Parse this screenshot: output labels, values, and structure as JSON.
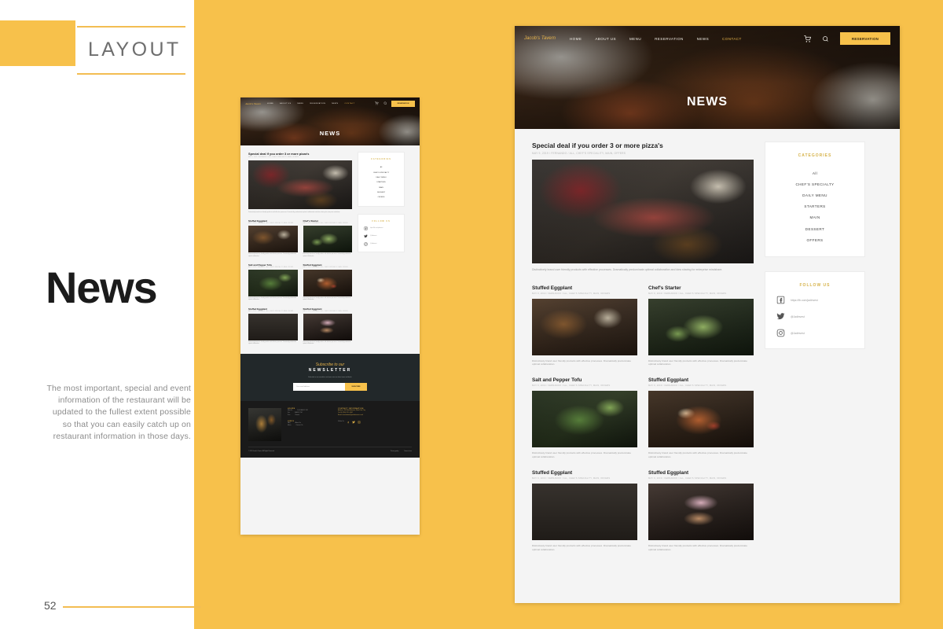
{
  "slide": {
    "section_label": "LAYOUT",
    "title": "News",
    "description": "The most important, special and event information of the restaurant will be updated to the fullest extent possible so that you can easily catch up on restaurant information in those days.",
    "page_number": "52",
    "accent_color": "#f7c14b",
    "text_gray": "#8c8c8c"
  },
  "site": {
    "brand": "Jacob's Tavern",
    "nav": [
      {
        "label": "HOME",
        "active": false
      },
      {
        "label": "ABOUT US",
        "active": false
      },
      {
        "label": "MENU",
        "active": false
      },
      {
        "label": "RESERVATION",
        "active": false
      },
      {
        "label": "NEWS",
        "active": false
      },
      {
        "label": "CONTACT",
        "active": true
      }
    ],
    "cart_icon": "cart-icon",
    "search_icon": "search-icon",
    "reservation_button": "RESERVATION",
    "hero_title": "NEWS"
  },
  "feature": {
    "title": "Special deal if you order 3 or more pizza's",
    "meta": "MAY 9, 2019 / FERNANDO / ALL, CHEF'S SPECIALITY, MAIN, OFFERS",
    "excerpt": "Distinctively brand user friendly products with effective processes. Dramatically predominate optimal collaboration and idea sharing for enterprise mindshare.",
    "image": "p-steak"
  },
  "cards": [
    {
      "title": "Stuffed Eggplant",
      "meta": "MAY 9, 2019 / FERNANDO / ALL, CHEF'S SPECIALITY, MAIN, OFFERS",
      "excerpt": "Distinctively brand user friendly products with effective processes. Dramatically predominate optimal collaboration.",
      "image": "p-board"
    },
    {
      "title": "Chef's Starter",
      "meta": "MAY 9, 2019 / FERNANDO / ALL, CHEF'S SPECIALITY, MAIN, OFFERS",
      "excerpt": "Distinctively brand user friendly products with effective processes. Dramatically predominate optimal collaboration.",
      "image": "p-macaron"
    },
    {
      "title": "Salt and Pepper Tofu",
      "meta": "MAY 9, 2019 / FERNANDO / ALL, CHEF'S SPECIALITY, MAIN, OFFERS",
      "excerpt": "Distinctively brand user friendly products with effective processes. Dramatically predominate optimal collaboration.",
      "image": "p-green"
    },
    {
      "title": "Stuffed Eggplant",
      "meta": "MAY 9, 2019 / FERNANDO / ALL, CHEF'S SPECIALITY, MAIN, OFFERS",
      "excerpt": "Distinctively brand user friendly products with effective processes. Dramatically predominate optimal collaboration.",
      "image": "p-pizza"
    },
    {
      "title": "Stuffed Eggplant",
      "meta": "MAY 9, 2019 / FERNANDO / ALL, CHEF'S SPECIALITY, MAIN, OFFERS",
      "excerpt": "Distinctively brand user friendly products with effective processes. Dramatically predominate optimal collaboration.",
      "image": "p-dark"
    },
    {
      "title": "Stuffed Eggplant",
      "meta": "MAY 9, 2019 / FERNANDO / ALL, CHEF'S SPECIALITY, MAIN, OFFERS",
      "excerpt": "Distinctively brand user friendly products with effective processes. Dramatically predominate optimal collaboration.",
      "image": "p-donut"
    }
  ],
  "sidebar": {
    "categories_title": "CATEGORIES",
    "categories": [
      "All",
      "CHEF'S SPECIALTY",
      "DAILY MENU",
      "STARTERS",
      "MAIN",
      "DESSERT",
      "OFFERS"
    ],
    "follow_title": "FOLLOW US",
    "socials": [
      {
        "icon": "facebook-icon",
        "handle": "https://fb.com/jadinvest"
      },
      {
        "icon": "twitter-icon",
        "handle": "@Jadinvest"
      },
      {
        "icon": "instagram-icon",
        "handle": "@Jadinvest"
      }
    ]
  },
  "newsletter": {
    "script": "Subscribe to our",
    "word": "NEWSLETTER",
    "sub": "Subscribe to our newsletter and never miss our latest news and deals.",
    "input_placeholder": "Your email address",
    "button": "SUBSCRIBE"
  },
  "footer": {
    "hours_head": "HOURS",
    "hours": [
      {
        "day": "Mon-Fri",
        "time": "10:00 AM-11 PM"
      },
      {
        "day": "Sat",
        "time": "9 AM-11 PM"
      },
      {
        "day": "Sun",
        "time": "Closed"
      }
    ],
    "links_head": "LINKS",
    "links": [
      {
        "label": "FAQ",
        "value": "About Us"
      },
      {
        "label": "Menu",
        "value": "Contact Us"
      }
    ],
    "contact_head": "CONTACT INFORMATION",
    "contact": [
      "Address: 100 North Avenue, West Park City",
      "Tel: 01 (555) 123 - 4567",
      "Email: reservations@jacobstavern.co.uk"
    ],
    "follow_label": "Follow Us",
    "copyright": "© 2019 Jacob's Tavern. All Rights Reserved.",
    "bottom_links": [
      "Privacy policy",
      "Terms of use"
    ]
  }
}
